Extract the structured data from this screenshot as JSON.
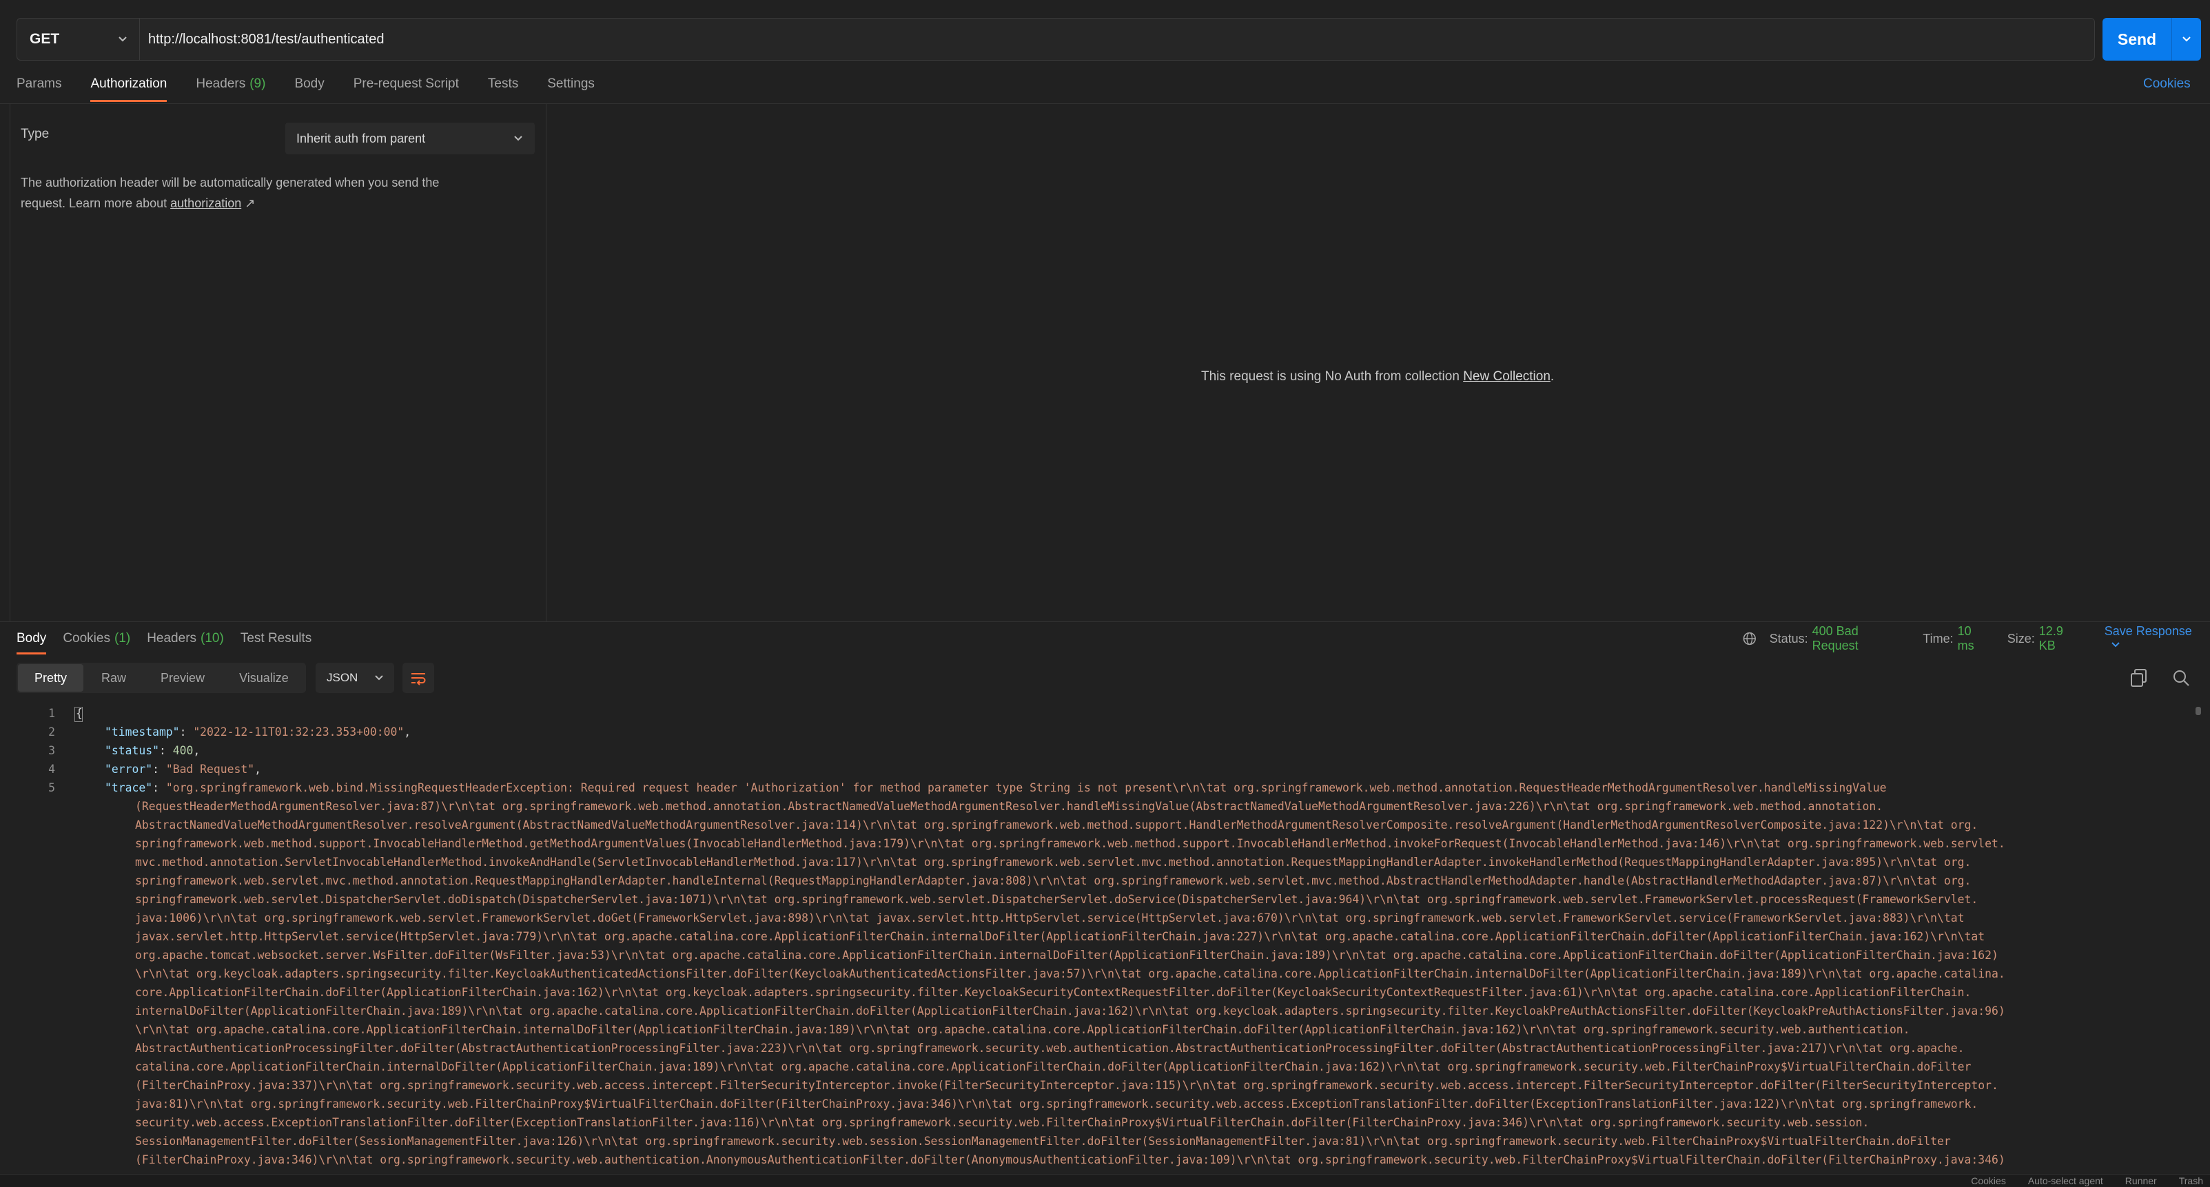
{
  "request": {
    "method": "GET",
    "url": "http://localhost:8081/test/authenticated",
    "send_label": "Send"
  },
  "request_tabs": [
    {
      "label": "Params",
      "count": ""
    },
    {
      "label": "Authorization",
      "count": ""
    },
    {
      "label": "Headers",
      "count": "(9)"
    },
    {
      "label": "Body",
      "count": ""
    },
    {
      "label": "Pre-request Script",
      "count": ""
    },
    {
      "label": "Tests",
      "count": ""
    },
    {
      "label": "Settings",
      "count": ""
    }
  ],
  "cookies_link": "Cookies",
  "auth": {
    "type_label": "Type",
    "type_value": "Inherit auth from parent",
    "description_1": "The authorization header will be automatically generated when you send the",
    "description_2": "request. Learn more about",
    "description_link": "authorization",
    "description_arrow": "↗",
    "no_auth_text": "This request is using No Auth from collection",
    "collection_link": "New Collection",
    "period": "."
  },
  "response_tabs": [
    {
      "label": "Body",
      "count": ""
    },
    {
      "label": "Cookies",
      "count": "(1)"
    },
    {
      "label": "Headers",
      "count": "(10)"
    },
    {
      "label": "Test Results",
      "count": ""
    }
  ],
  "response_status": {
    "status_label": "Status:",
    "status_value": "400 Bad Request",
    "time_label": "Time:",
    "time_value": "10 ms",
    "size_label": "Size:",
    "size_value": "12.9 KB",
    "save_label": "Save Response"
  },
  "response_toolbar": {
    "formats": [
      "Pretty",
      "Raw",
      "Preview",
      "Visualize"
    ],
    "language": "JSON"
  },
  "code": {
    "line_numbers": [
      "1",
      "2",
      "3",
      "4",
      "5"
    ],
    "open_brace": "{",
    "timestamp_key": "\"timestamp\"",
    "timestamp_value": "\"2022-12-11T01:32:23.353+00:00\"",
    "status_key": "\"status\"",
    "status_value": "400",
    "error_key": "\"error\"",
    "error_value": "\"Bad Request\"",
    "trace_key": "\"trace\"",
    "trace_lines": [
      "\"org.springframework.web.bind.MissingRequestHeaderException: Required request header 'Authorization' for method parameter type String is not present\\r\\n\\tat org.springframework.web.method.annotation.RequestHeaderMethodArgumentResolver.handleMissingValue",
      "(RequestHeaderMethodArgumentResolver.java:87)\\r\\n\\tat org.springframework.web.method.annotation.AbstractNamedValueMethodArgumentResolver.handleMissingValue(AbstractNamedValueMethodArgumentResolver.java:226)\\r\\n\\tat org.springframework.web.method.annotation.",
      "AbstractNamedValueMethodArgumentResolver.resolveArgument(AbstractNamedValueMethodArgumentResolver.java:114)\\r\\n\\tat org.springframework.web.method.support.HandlerMethodArgumentResolverComposite.resolveArgument(HandlerMethodArgumentResolverComposite.java:122)\\r\\n\\tat org.",
      "springframework.web.method.support.InvocableHandlerMethod.getMethodArgumentValues(InvocableHandlerMethod.java:179)\\r\\n\\tat org.springframework.web.method.support.InvocableHandlerMethod.invokeForRequest(InvocableHandlerMethod.java:146)\\r\\n\\tat org.springframework.web.servlet.",
      "mvc.method.annotation.ServletInvocableHandlerMethod.invokeAndHandle(ServletInvocableHandlerMethod.java:117)\\r\\n\\tat org.springframework.web.servlet.mvc.method.annotation.RequestMappingHandlerAdapter.invokeHandlerMethod(RequestMappingHandlerAdapter.java:895)\\r\\n\\tat org.",
      "springframework.web.servlet.mvc.method.annotation.RequestMappingHandlerAdapter.handleInternal(RequestMappingHandlerAdapter.java:808)\\r\\n\\tat org.springframework.web.servlet.mvc.method.AbstractHandlerMethodAdapter.handle(AbstractHandlerMethodAdapter.java:87)\\r\\n\\tat org.",
      "springframework.web.servlet.DispatcherServlet.doDispatch(DispatcherServlet.java:1071)\\r\\n\\tat org.springframework.web.servlet.DispatcherServlet.doService(DispatcherServlet.java:964)\\r\\n\\tat org.springframework.web.servlet.FrameworkServlet.processRequest(FrameworkServlet.",
      "java:1006)\\r\\n\\tat org.springframework.web.servlet.FrameworkServlet.doGet(FrameworkServlet.java:898)\\r\\n\\tat javax.servlet.http.HttpServlet.service(HttpServlet.java:670)\\r\\n\\tat org.springframework.web.servlet.FrameworkServlet.service(FrameworkServlet.java:883)\\r\\n\\tat",
      "javax.servlet.http.HttpServlet.service(HttpServlet.java:779)\\r\\n\\tat org.apache.catalina.core.ApplicationFilterChain.internalDoFilter(ApplicationFilterChain.java:227)\\r\\n\\tat org.apache.catalina.core.ApplicationFilterChain.doFilter(ApplicationFilterChain.java:162)\\r\\n\\tat",
      "org.apache.tomcat.websocket.server.WsFilter.doFilter(WsFilter.java:53)\\r\\n\\tat org.apache.catalina.core.ApplicationFilterChain.internalDoFilter(ApplicationFilterChain.java:189)\\r\\n\\tat org.apache.catalina.core.ApplicationFilterChain.doFilter(ApplicationFilterChain.java:162)",
      "\\r\\n\\tat org.keycloak.adapters.springsecurity.filter.KeycloakAuthenticatedActionsFilter.doFilter(KeycloakAuthenticatedActionsFilter.java:57)\\r\\n\\tat org.apache.catalina.core.ApplicationFilterChain.internalDoFilter(ApplicationFilterChain.java:189)\\r\\n\\tat org.apache.catalina.",
      "core.ApplicationFilterChain.doFilter(ApplicationFilterChain.java:162)\\r\\n\\tat org.keycloak.adapters.springsecurity.filter.KeycloakSecurityContextRequestFilter.doFilter(KeycloakSecurityContextRequestFilter.java:61)\\r\\n\\tat org.apache.catalina.core.ApplicationFilterChain.",
      "internalDoFilter(ApplicationFilterChain.java:189)\\r\\n\\tat org.apache.catalina.core.ApplicationFilterChain.doFilter(ApplicationFilterChain.java:162)\\r\\n\\tat org.keycloak.adapters.springsecurity.filter.KeycloakPreAuthActionsFilter.doFilter(KeycloakPreAuthActionsFilter.java:96)",
      "\\r\\n\\tat org.apache.catalina.core.ApplicationFilterChain.internalDoFilter(ApplicationFilterChain.java:189)\\r\\n\\tat org.apache.catalina.core.ApplicationFilterChain.doFilter(ApplicationFilterChain.java:162)\\r\\n\\tat org.springframework.security.web.authentication.",
      "AbstractAuthenticationProcessingFilter.doFilter(AbstractAuthenticationProcessingFilter.java:223)\\r\\n\\tat org.springframework.security.web.authentication.AbstractAuthenticationProcessingFilter.doFilter(AbstractAuthenticationProcessingFilter.java:217)\\r\\n\\tat org.apache.",
      "catalina.core.ApplicationFilterChain.internalDoFilter(ApplicationFilterChain.java:189)\\r\\n\\tat org.apache.catalina.core.ApplicationFilterChain.doFilter(ApplicationFilterChain.java:162)\\r\\n\\tat org.springframework.security.web.FilterChainProxy$VirtualFilterChain.doFilter",
      "(FilterChainProxy.java:337)\\r\\n\\tat org.springframework.security.web.access.intercept.FilterSecurityInterceptor.invoke(FilterSecurityInterceptor.java:115)\\r\\n\\tat org.springframework.security.web.access.intercept.FilterSecurityInterceptor.doFilter(FilterSecurityInterceptor.",
      "java:81)\\r\\n\\tat org.springframework.security.web.FilterChainProxy$VirtualFilterChain.doFilter(FilterChainProxy.java:346)\\r\\n\\tat org.springframework.security.web.access.ExceptionTranslationFilter.doFilter(ExceptionTranslationFilter.java:122)\\r\\n\\tat org.springframework.",
      "security.web.access.ExceptionTranslationFilter.doFilter(ExceptionTranslationFilter.java:116)\\r\\n\\tat org.springframework.security.web.FilterChainProxy$VirtualFilterChain.doFilter(FilterChainProxy.java:346)\\r\\n\\tat org.springframework.security.web.session.",
      "SessionManagementFilter.doFilter(SessionManagementFilter.java:126)\\r\\n\\tat org.springframework.security.web.session.SessionManagementFilter.doFilter(SessionManagementFilter.java:81)\\r\\n\\tat org.springframework.security.web.FilterChainProxy$VirtualFilterChain.doFilter",
      "(FilterChainProxy.java:346)\\r\\n\\tat org.springframework.security.web.authentication.AnonymousAuthenticationFilter.doFilter(AnonymousAuthenticationFilter.java:109)\\r\\n\\tat org.springframework.security.web.FilterChainProxy$VirtualFilterChain.doFilter(FilterChainProxy.java:346)"
    ]
  },
  "colors": {
    "accent_tab": "#ff6c37",
    "send_button": "#097bed",
    "link": "#3a8fe8",
    "success": "#4caf50",
    "json_key": "#9cdcfe",
    "json_string": "#ce9178"
  },
  "footer": {
    "items": [
      "Cookies",
      "Auto-select agent",
      "Runner",
      "Trash"
    ]
  }
}
